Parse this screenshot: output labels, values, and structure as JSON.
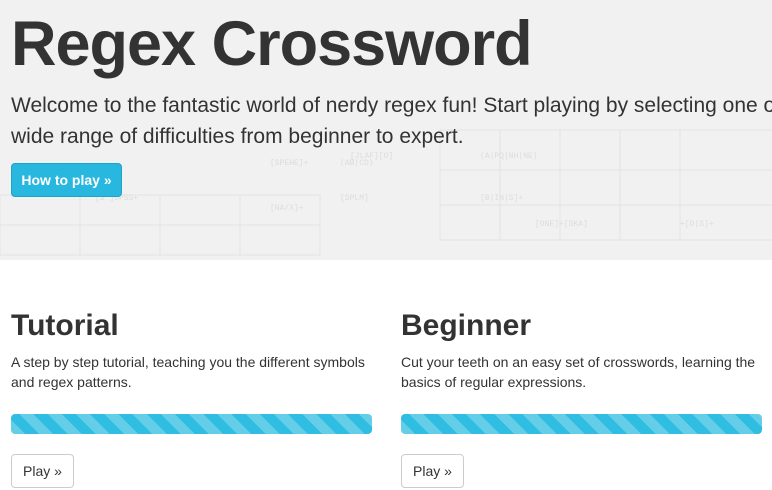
{
  "hero": {
    "title": "Regex Crossword",
    "subtitle_line1": "Welcome to the fantastic world of nerdy regex fun! Start playing by selecting one of t",
    "subtitle_line2": "wide range of difficulties from beginner to expert.",
    "how_to_play_label": "How to play »",
    "button_color": "#28b7de"
  },
  "cards": [
    {
      "title": "Tutorial",
      "description": "A step by step tutorial, teaching you the different symbols and regex patterns.",
      "progress": 1.0,
      "play_label": "Play »"
    },
    {
      "title": "Beginner",
      "description": "Cut your teeth on an easy set of crosswords, learning the basics of regular expressions.",
      "progress": 1.0,
      "play_label": "Play »"
    }
  ],
  "colors": {
    "progress_fill": "#30bde2",
    "text": "#333333"
  }
}
